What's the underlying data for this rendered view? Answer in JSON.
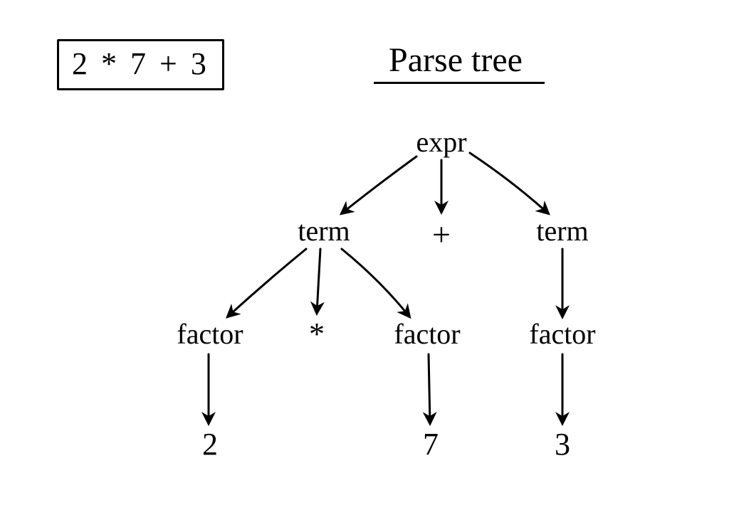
{
  "expression": "2 * 7 + 3",
  "title": "Parse tree",
  "nodes": {
    "expr": "expr",
    "term_left": "term",
    "plus": "+",
    "term_right": "term",
    "factor_l": "factor",
    "star": "*",
    "factor_m": "factor",
    "factor_r": "factor",
    "leaf_2": "2",
    "leaf_7": "7",
    "leaf_3": "3"
  }
}
